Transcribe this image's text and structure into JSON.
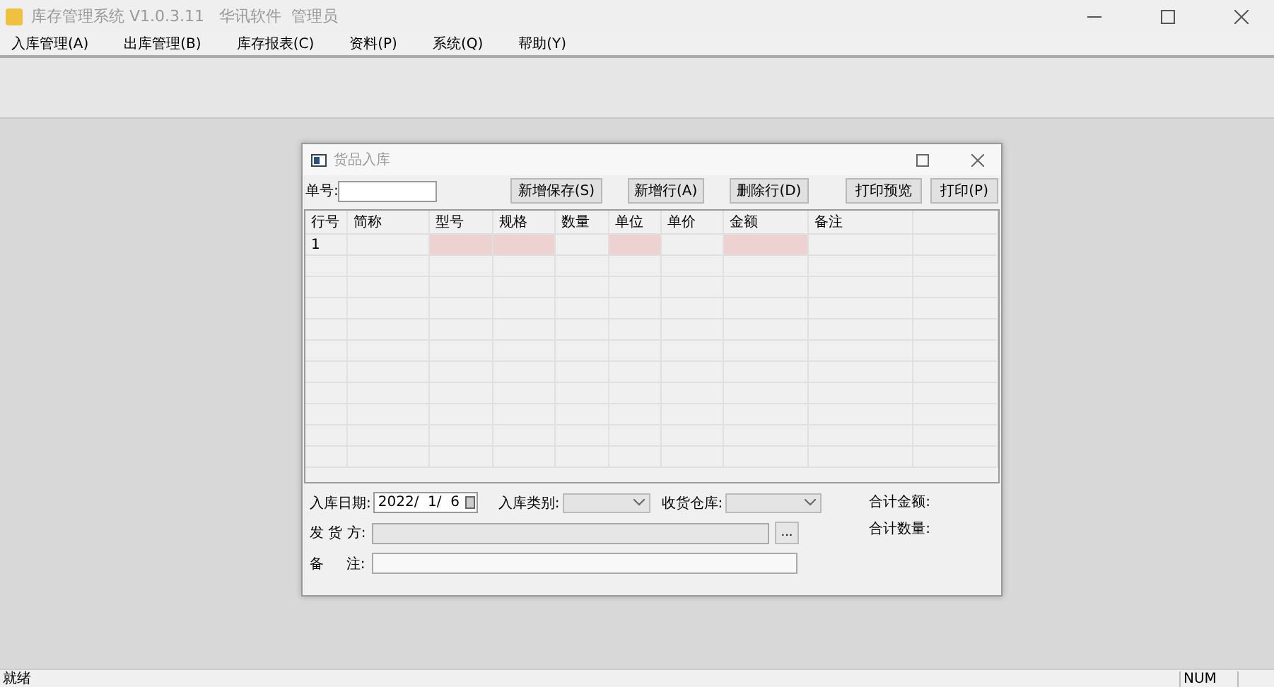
{
  "window": {
    "title": "库存管理系统 V1.0.3.11   华讯软件  管理员"
  },
  "menu": [
    {
      "label": "入库管理(A)"
    },
    {
      "label": "出库管理(B)"
    },
    {
      "label": "库存报表(C)"
    },
    {
      "label": "资料(P)"
    },
    {
      "label": "系统(Q)"
    },
    {
      "label": "帮助(Y)"
    }
  ],
  "child_window": {
    "title": "货品入库",
    "toolbar": {
      "number_label": "单号:",
      "buttons": [
        {
          "label": "新增保存(S)"
        },
        {
          "label": "新增行(A)"
        },
        {
          "label": "删除行(D)"
        }
      ],
      "right_buttons": [
        {
          "label": "打印预览"
        },
        {
          "label": "打印(P)"
        }
      ]
    },
    "table": {
      "columns": [
        {
          "label": "行号",
          "required": false
        },
        {
          "label": "简称",
          "required": false
        },
        {
          "label": "型号",
          "required": true
        },
        {
          "label": "规格",
          "required": true
        },
        {
          "label": "数量",
          "required": false
        },
        {
          "label": "单位",
          "required": true
        },
        {
          "label": "单价",
          "required": false
        },
        {
          "label": "金额",
          "required": true
        },
        {
          "label": "备注",
          "required": false
        }
      ],
      "rows": [
        {
          "row_number": "1"
        }
      ]
    },
    "form": {
      "date_label": "入库日期:",
      "date_value": "2022/  1/  6",
      "type_label": "入库类别:",
      "warehouse_label": "收货仓库:",
      "supplier_label": "发 货 方:",
      "supplier_button": "...",
      "note_label": "备     注:",
      "total_amount_label": "合计金额:",
      "total_quantity_label": "合计数量:"
    }
  },
  "status_bar": {
    "left": "就绪",
    "right": "NUM"
  }
}
